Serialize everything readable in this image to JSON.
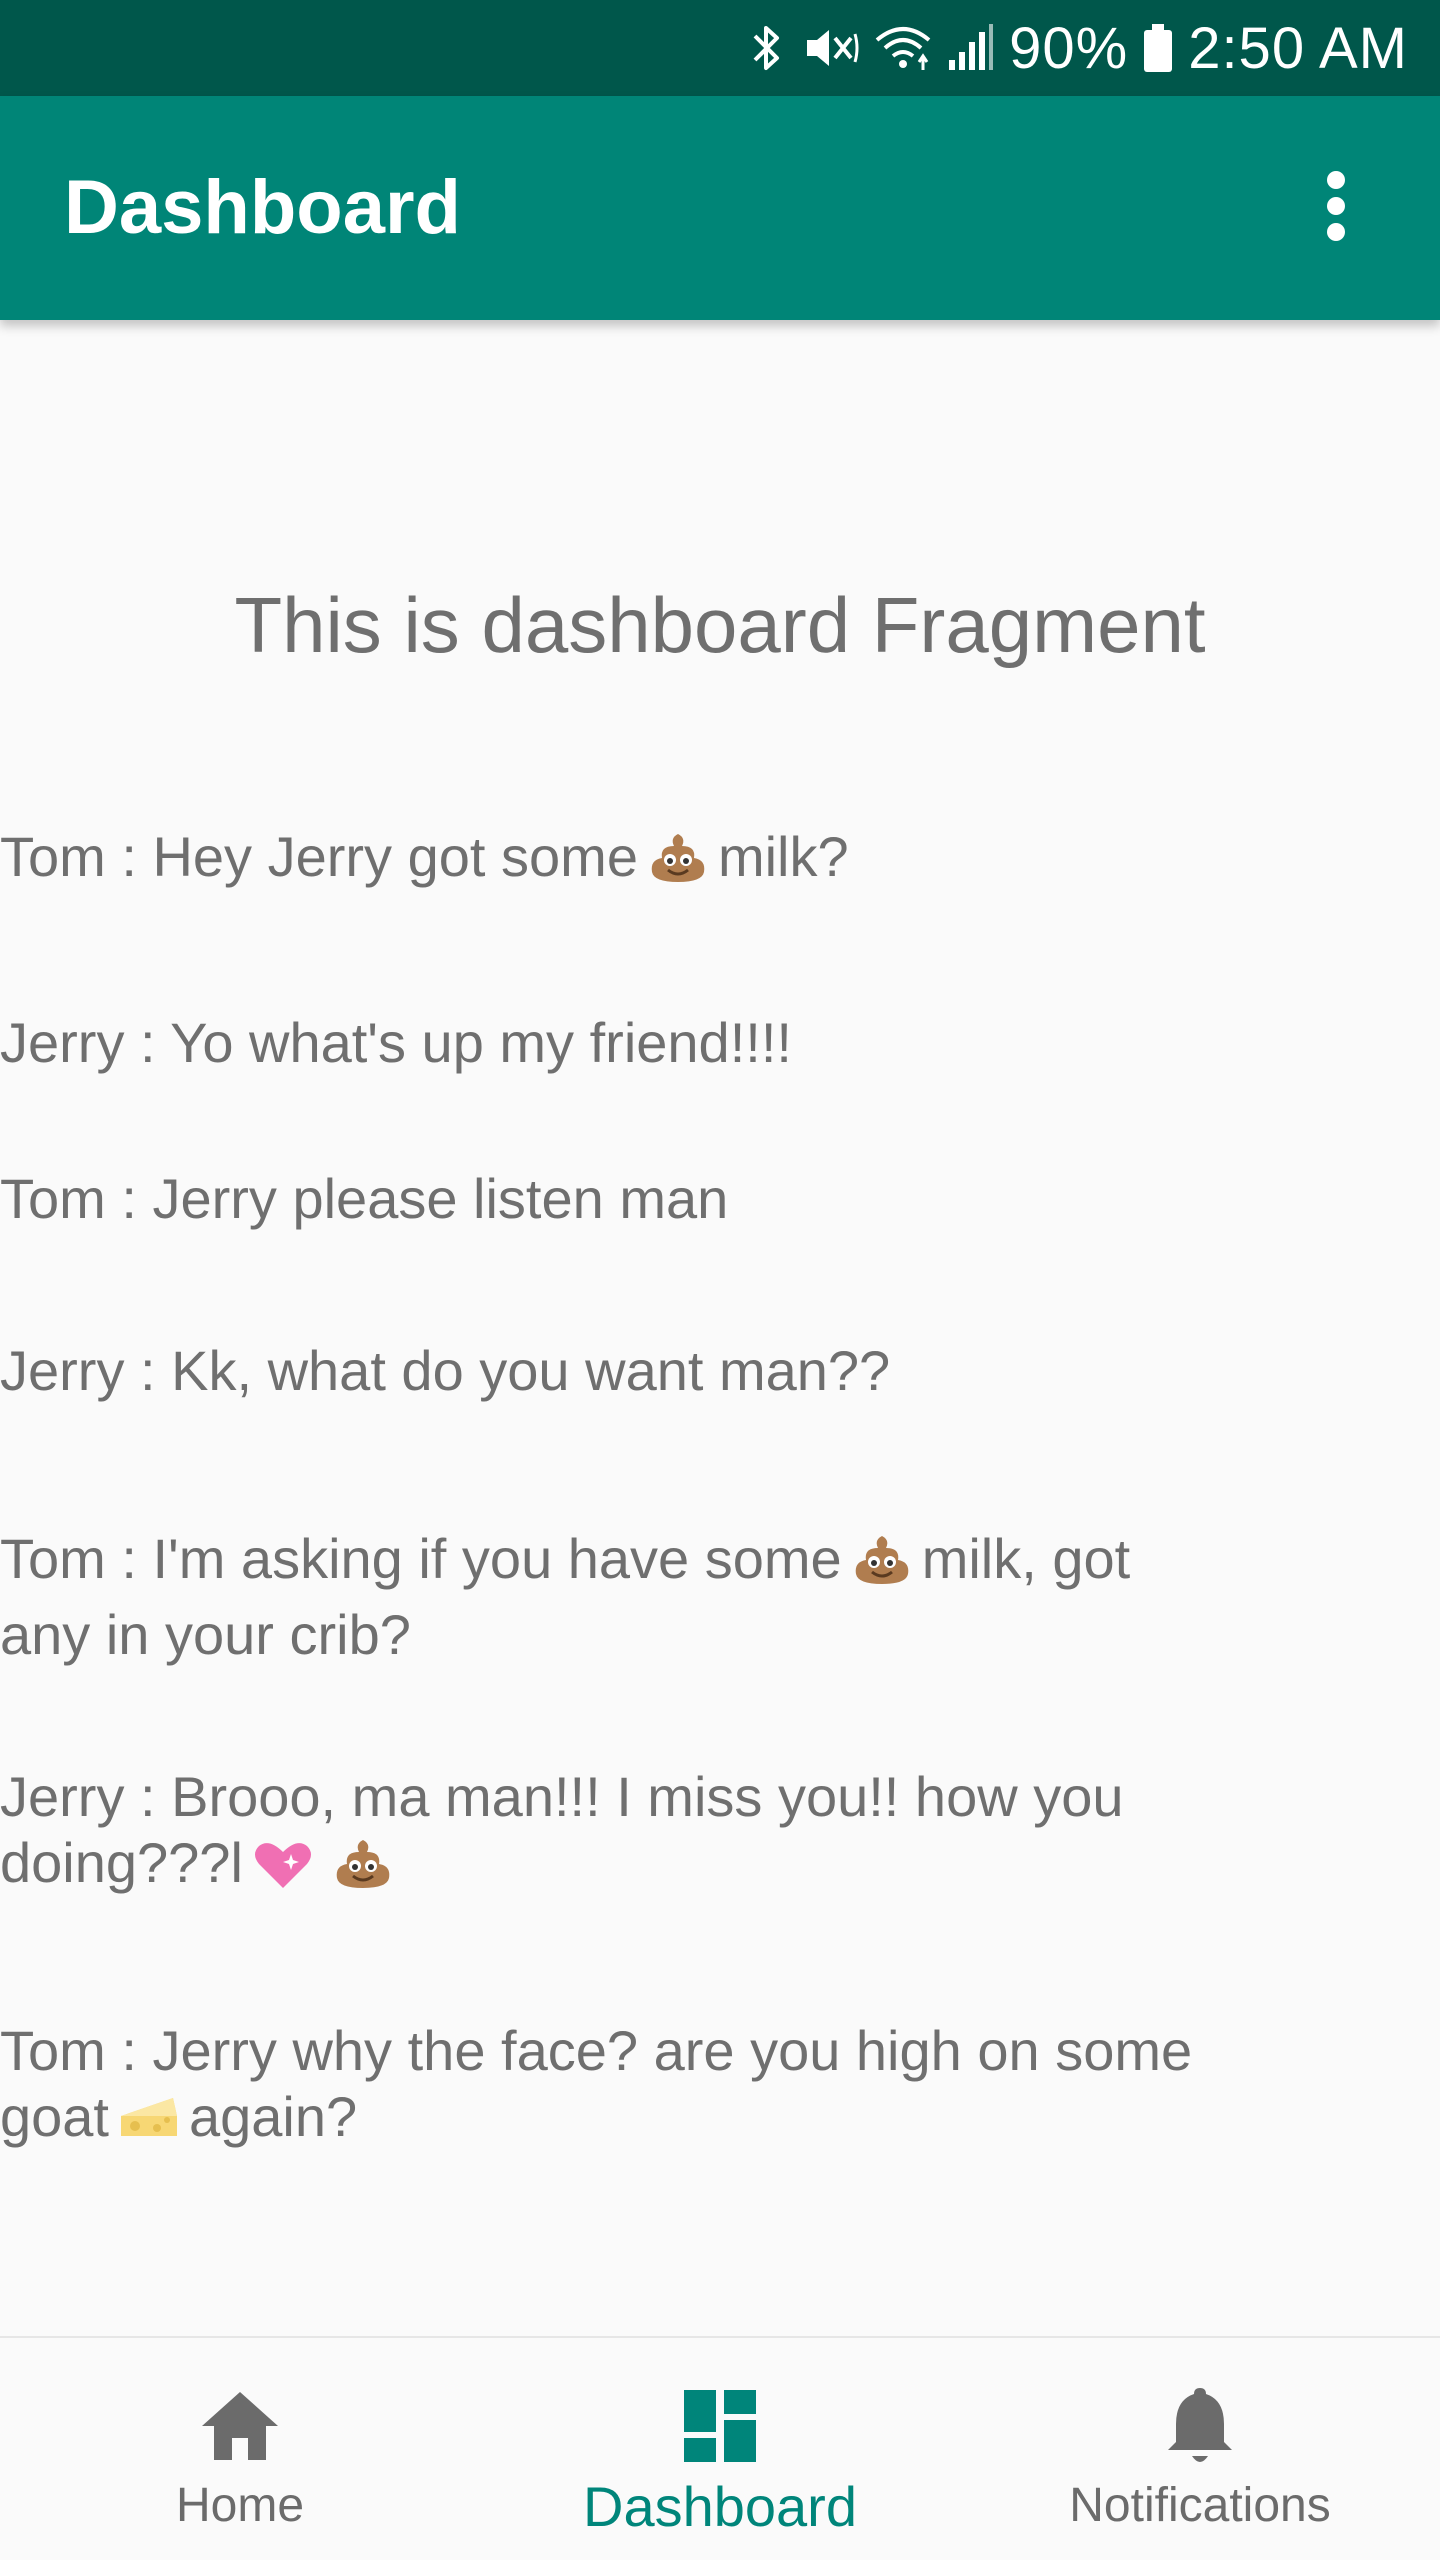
{
  "status_bar": {
    "battery": "90%",
    "time": "2:50 AM",
    "icons": [
      "bluetooth-icon",
      "vibrate-mute-icon",
      "wifi-icon",
      "signal-icon",
      "battery-icon"
    ]
  },
  "app_bar": {
    "title": "Dashboard",
    "overflow_icon": "more-vert-icon"
  },
  "content": {
    "fragment_text": "This is dashboard Fragment",
    "messages": [
      {
        "prefix": "Tom : Hey Jerry got some",
        "emoji_1": "poop",
        "suffix": "milk?"
      },
      {
        "text": "Jerry : Yo what's up my friend!!!!"
      },
      {
        "text": "Tom : Jerry please listen man"
      },
      {
        "text": "Jerry : Kk, what do you want man??"
      },
      {
        "prefix": "Tom : I'm asking if you have some",
        "emoji_1": "poop",
        "suffix": "milk, got any in your crib?"
      },
      {
        "prefix": "Jerry : Brooo, ma man!!! I miss you!! how you doing???l",
        "emoji_1": "sparkling-heart",
        "emoji_2": "poop"
      },
      {
        "prefix": "Tom : Jerry why the face? are you high on some goat",
        "emoji_1": "cheese",
        "suffix": "again?"
      }
    ]
  },
  "bottom_nav": {
    "items": [
      {
        "label": "Home",
        "icon": "home-icon",
        "active": false
      },
      {
        "label": "Dashboard",
        "icon": "dashboard-icon",
        "active": true
      },
      {
        "label": "Notifications",
        "icon": "bell-icon",
        "active": false
      }
    ]
  },
  "colors": {
    "status_bar": "#00574b",
    "primary": "#008577",
    "accent": "#00857a",
    "text": "#6f6f6f",
    "background": "#fafafa"
  }
}
